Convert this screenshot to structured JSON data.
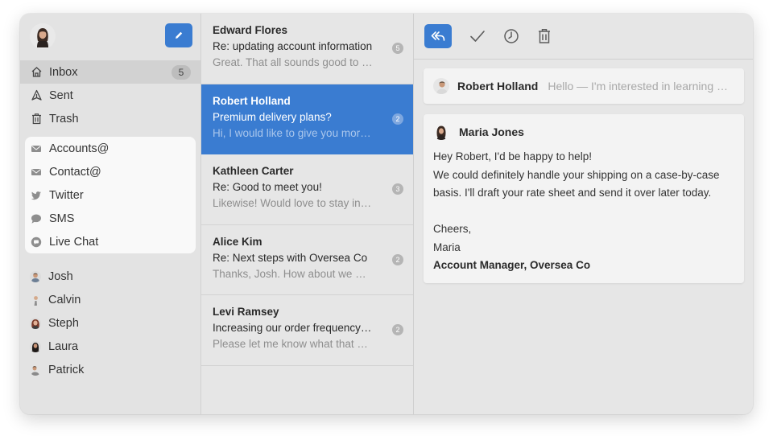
{
  "sidebar": {
    "mailboxes": [
      {
        "label": "Inbox",
        "icon": "home-icon",
        "badge": "5"
      },
      {
        "label": "Sent",
        "icon": "send-icon"
      },
      {
        "label": "Trash",
        "icon": "trash-icon"
      }
    ],
    "channels": [
      {
        "label": "Accounts@",
        "icon": "envelope-icon"
      },
      {
        "label": "Contact@",
        "icon": "envelope-icon"
      },
      {
        "label": "Twitter",
        "icon": "twitter-icon"
      },
      {
        "label": "SMS",
        "icon": "chat-bubble-icon"
      },
      {
        "label": "Live Chat",
        "icon": "live-chat-icon"
      }
    ],
    "people": [
      {
        "label": "Josh"
      },
      {
        "label": "Calvin"
      },
      {
        "label": "Steph"
      },
      {
        "label": "Laura"
      },
      {
        "label": "Patrick"
      }
    ]
  },
  "messages": [
    {
      "from": "Edward Flores",
      "subject": "Re: updating account information",
      "preview": "Great. That all sounds good to me",
      "count": "5"
    },
    {
      "from": "Robert Holland",
      "subject": "Premium delivery plans?",
      "preview": "Hi, I would like to give you more details",
      "count": "2",
      "selected": true
    },
    {
      "from": "Kathleen Carter",
      "subject": "Re: Good to meet you!",
      "preview": "Likewise! Would love to stay in touch",
      "count": "3"
    },
    {
      "from": "Alice Kim",
      "subject": "Re: Next steps with Oversea Co",
      "preview": "Thanks, Josh. How about we meet",
      "count": "2"
    },
    {
      "from": "Levi Ramsey",
      "subject": "Increasing our order frequency soon",
      "preview": "Please let me know what that would cost",
      "count": "2"
    }
  ],
  "thread": {
    "collapsed": {
      "name": "Robert Holland",
      "snippet": "Hello — I'm interested in learning more about premium plans"
    },
    "open": {
      "name": "Maria Jones",
      "lines": [
        "Hey Robert, I'd be happy to help!",
        "We could definitely handle your shipping on a case-by-case",
        "basis. I'll draft your rate sheet and send it over later today.",
        "",
        "Cheers,",
        "Maria"
      ],
      "signature": "Account Manager, Oversea Co"
    }
  },
  "colors": {
    "accent": "#3a7cd1",
    "sidebar_bg": "#e3e3e3",
    "pane_bg": "#e6e6e6"
  }
}
